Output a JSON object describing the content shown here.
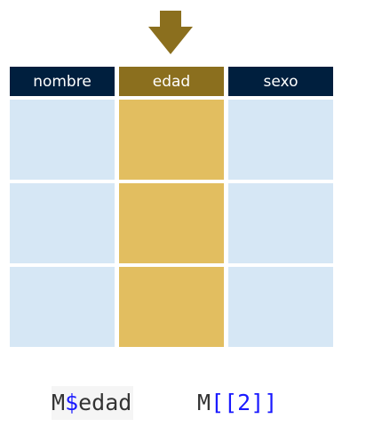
{
  "colors": {
    "header_dark": "#001f3e",
    "header_highlight": "#8b6f1e",
    "cell_light": "#d6e7f5",
    "cell_highlight": "#e2be60",
    "arrow": "#8b6f1e",
    "operator": "#1a1aff"
  },
  "diagram": {
    "columns": [
      {
        "name": "nombre",
        "highlighted": false
      },
      {
        "name": "edad",
        "highlighted": true
      },
      {
        "name": "sexo",
        "highlighted": false
      }
    ],
    "row_count": 3,
    "arrow_icon": "down-arrow-icon"
  },
  "code": {
    "dollar_prefix": "M",
    "dollar_op": "$",
    "dollar_field": "edad",
    "bracket_prefix": "M",
    "bracket_open": "[[",
    "bracket_index": "2",
    "bracket_close": "]]"
  }
}
